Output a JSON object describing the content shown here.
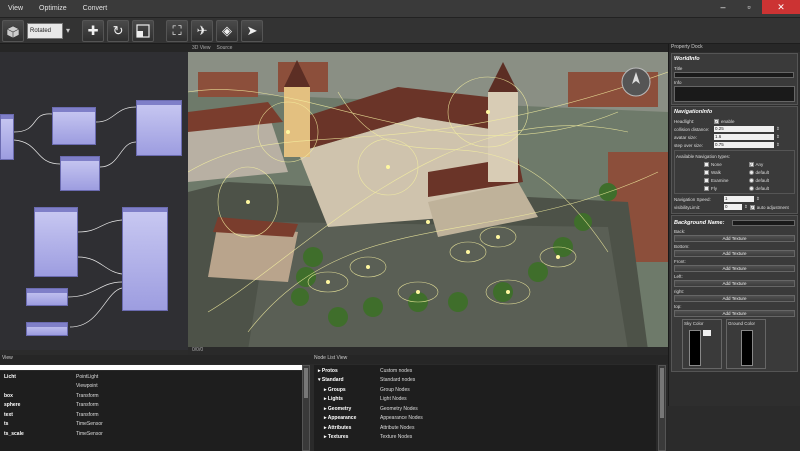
{
  "menubar": {
    "items": [
      "View",
      "Optimize",
      "Convert"
    ]
  },
  "toolbar": {
    "select_value": "Rotated"
  },
  "tabs": {
    "view_tab": "3D View",
    "source_tab": "Source"
  },
  "view_status": "0/0/0",
  "property_dock": {
    "title": "Property Dock",
    "worldinfo": {
      "title": "WorldInfo",
      "title_label": "Title",
      "info_label": "Info"
    },
    "navinfo": {
      "title": "NavigationInfo",
      "headlight_label": "Headlight:",
      "headlight_check": "enable",
      "collision_label": "collision distance:",
      "collision_value": "0.25",
      "avatar_label": "avatar size:",
      "avatar_value": "1.6",
      "step_label": "step over size:",
      "step_value": "0.75",
      "types_label": "Available Navigation types:",
      "types": [
        {
          "name": "None",
          "checked": false
        },
        {
          "name": "Any",
          "checked": true
        },
        {
          "name": "Walk",
          "checked": false
        },
        {
          "name": "default",
          "checked": false
        },
        {
          "name": "Examine",
          "checked": false
        },
        {
          "name": "default",
          "checked": false
        },
        {
          "name": "Fly",
          "checked": false
        },
        {
          "name": "default",
          "checked": false
        }
      ],
      "speed_label": "Navigation Speed:",
      "speed_value": "1",
      "visibility_label": "visibilityLimit:",
      "visibility_value": "0",
      "auto_adjust": "auto adjustment"
    },
    "background": {
      "title": "Background Name:",
      "faces": [
        "Back:",
        "Bottom:",
        "Front:",
        "Left:",
        "right:",
        "top:"
      ],
      "button_label": "Add Texture",
      "sky_color": "Sky Color",
      "ground_color": "Ground Color"
    }
  },
  "scene_list": {
    "title": "View",
    "rows": [
      {
        "name": "Licht",
        "type": "PointLight"
      },
      {
        "name": "",
        "type": "Viewpoint"
      },
      {
        "name": "box",
        "type": "Transform"
      },
      {
        "name": "sphere",
        "type": "Transform"
      },
      {
        "name": "text",
        "type": "Transform"
      },
      {
        "name": "ts",
        "type": "TimeSensor"
      },
      {
        "name": "ts_scale",
        "type": "TimeSensor"
      }
    ]
  },
  "node_list": {
    "title": "Node List View",
    "rows": [
      {
        "name": "Protos",
        "desc": "Custom nodes",
        "indent": 0
      },
      {
        "name": "Standard",
        "desc": "Standard nodes",
        "indent": 0
      },
      {
        "name": "Groups",
        "desc": "Group Nodes",
        "indent": 1
      },
      {
        "name": "Lights",
        "desc": "Light Nodes",
        "indent": 1
      },
      {
        "name": "Geometry",
        "desc": "Geometry Nodes",
        "indent": 1
      },
      {
        "name": "Appearance",
        "desc": "Appearance Nodes",
        "indent": 1
      },
      {
        "name": "Attributes",
        "desc": "Attribute Nodes",
        "indent": 1
      },
      {
        "name": "Textures",
        "desc": "Texture Nodes",
        "indent": 1
      }
    ]
  }
}
